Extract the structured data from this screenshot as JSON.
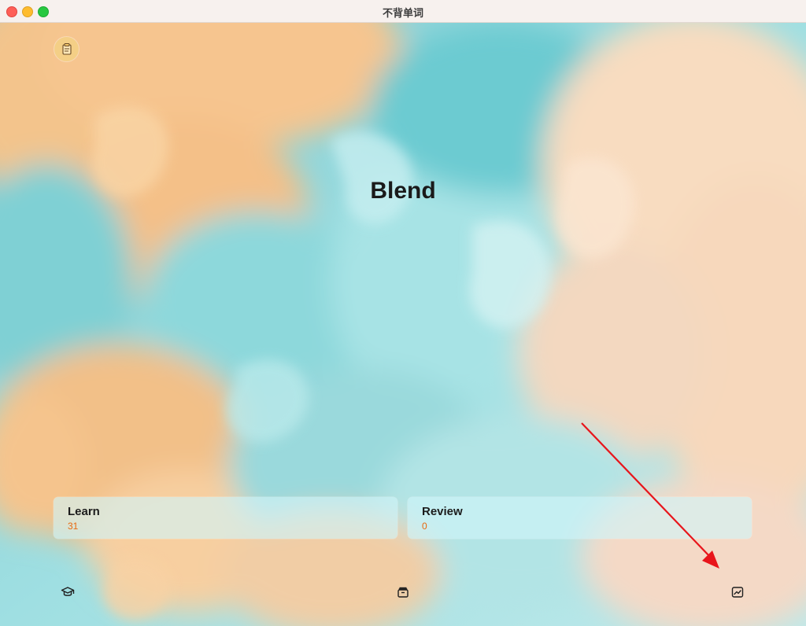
{
  "window": {
    "title": "不背单词"
  },
  "main": {
    "headline": "Blend",
    "cards": {
      "learn": {
        "label": "Learn",
        "count": "31"
      },
      "review": {
        "label": "Review",
        "count": "0"
      }
    }
  },
  "bottom_nav": {
    "items": [
      {
        "icon": "graduation-cap-icon"
      },
      {
        "icon": "tray-icon"
      },
      {
        "icon": "chart-icon"
      }
    ]
  },
  "colors": {
    "count_accent": "#e8690f",
    "annotation_arrow": "#e8151b",
    "smoke_teal": "#8fd6d8",
    "smoke_orange": "#f2bf86"
  }
}
